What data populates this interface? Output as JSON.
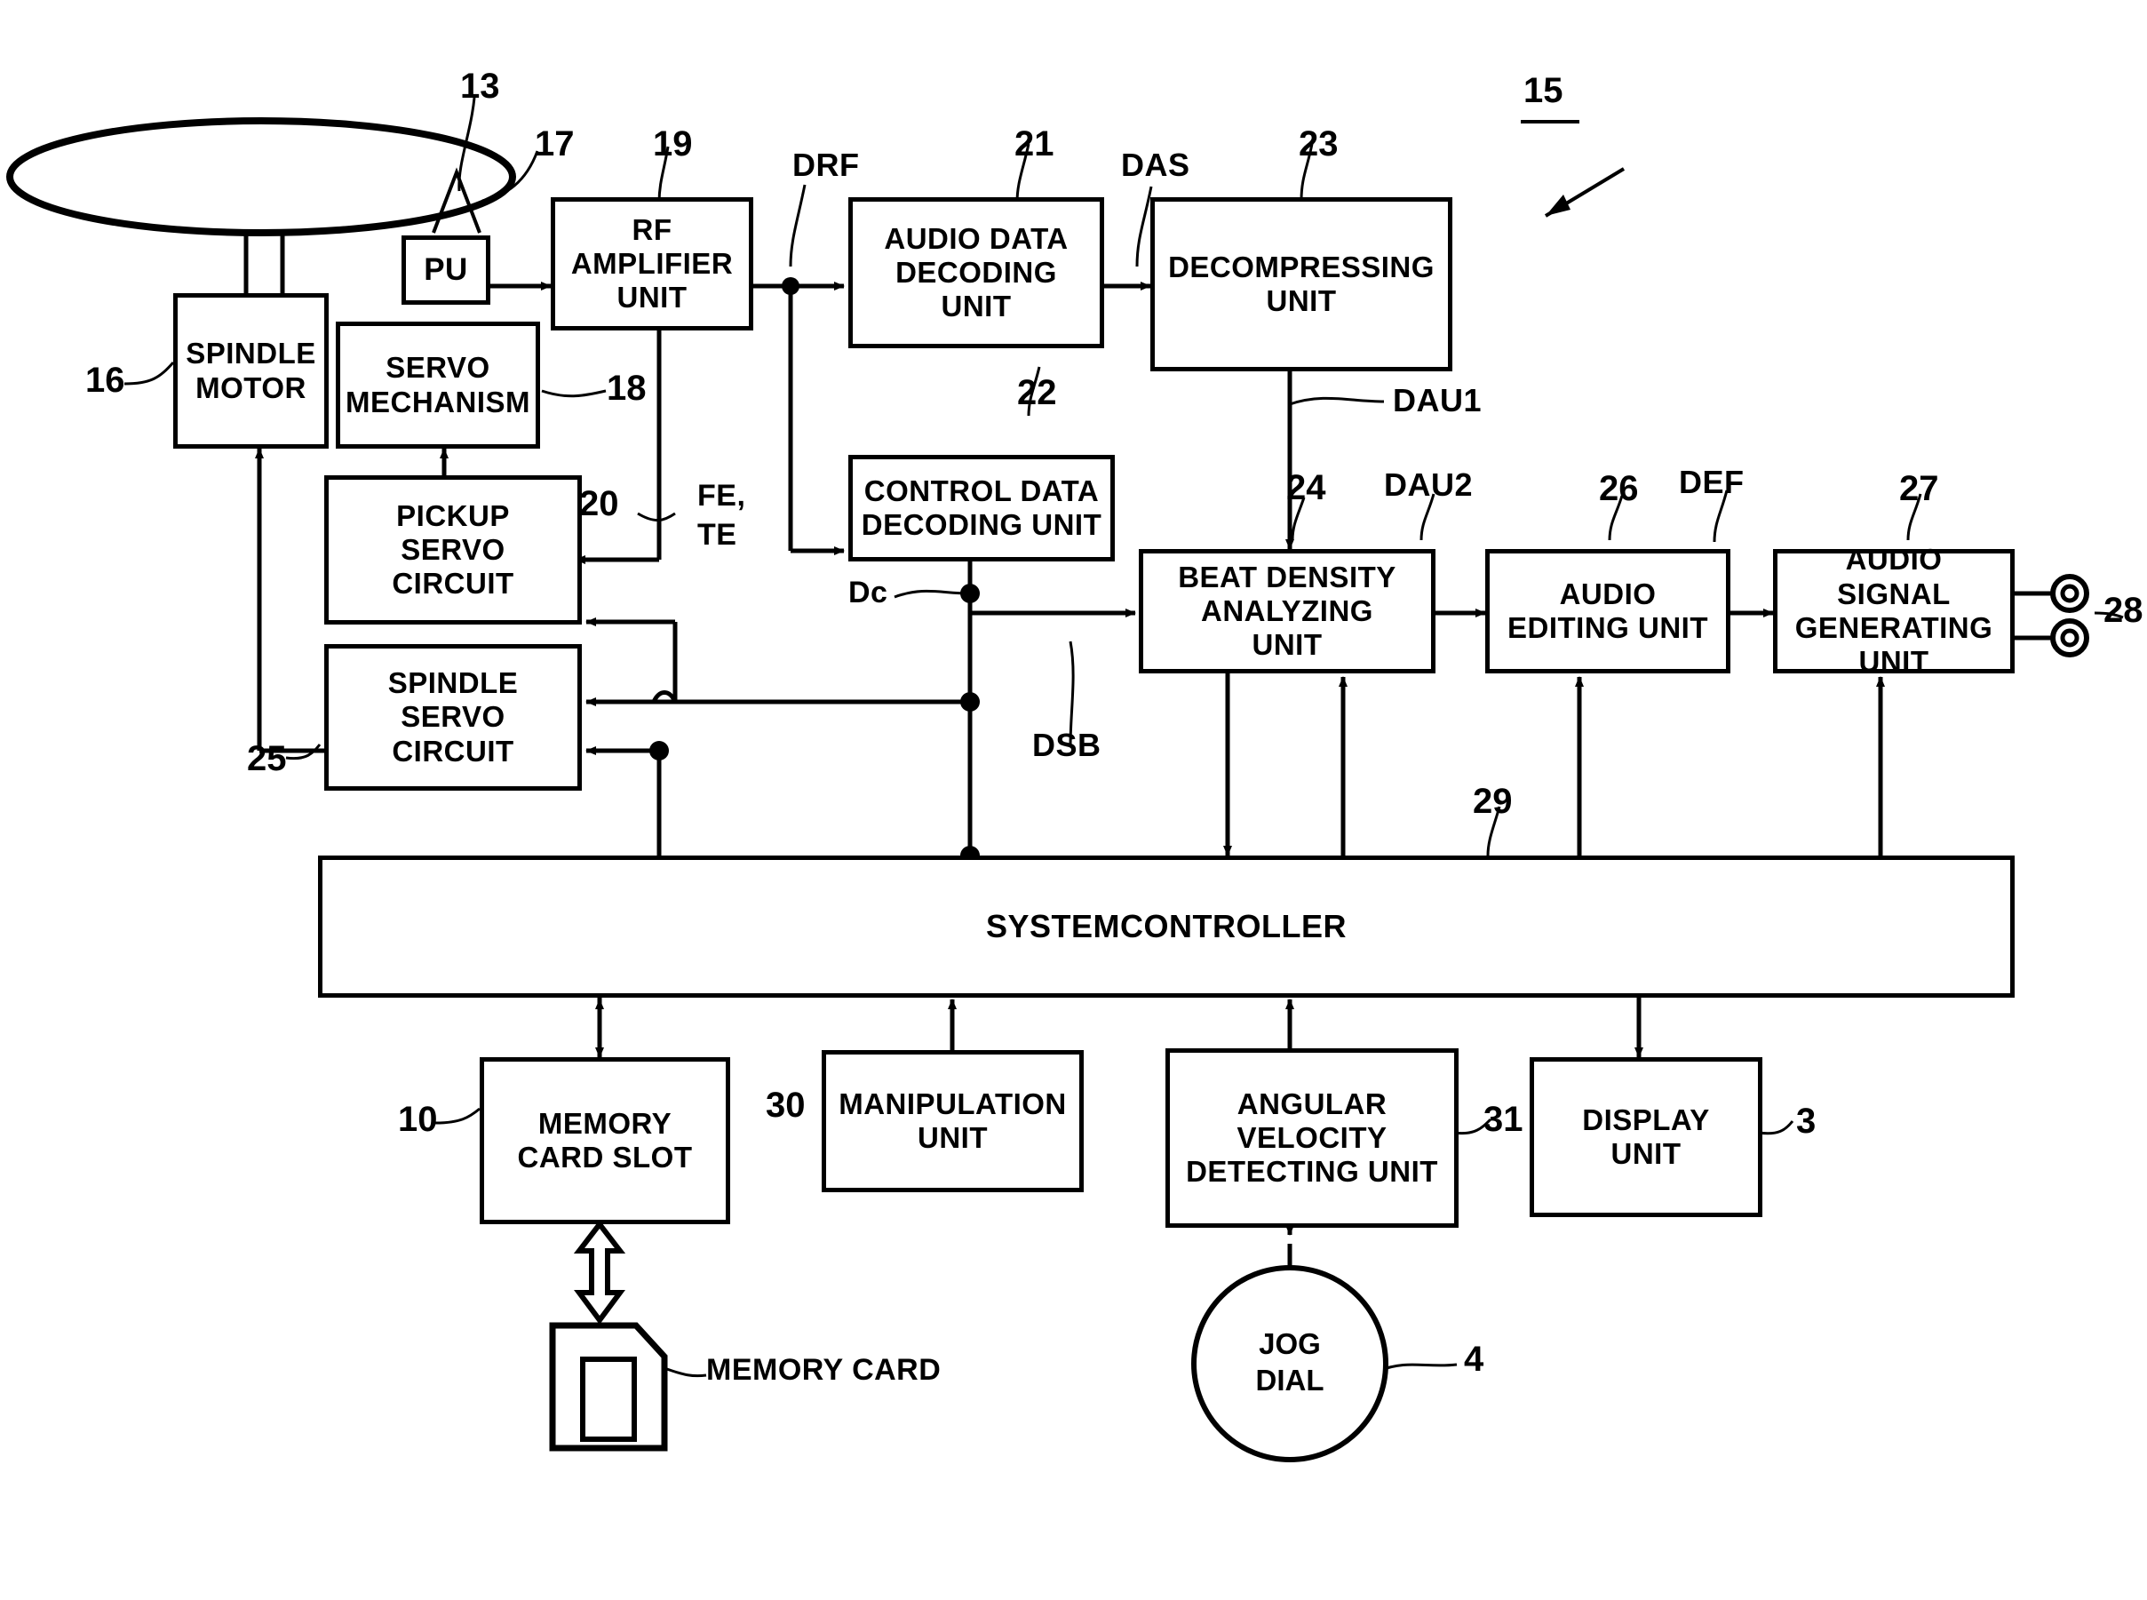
{
  "figure": {
    "kind": "patent-block-diagram",
    "title_ref": "15",
    "background": "#ffffff",
    "ink": "#000000"
  },
  "blocks": {
    "spindle_motor": {
      "label": "SPINDLE\nMOTOR",
      "line1": "SPINDLE",
      "line2": "MOTOR",
      "ref": "16"
    },
    "servo_mechanism": {
      "line1": "SERVO",
      "line2": "MECHANISM",
      "ref": "18"
    },
    "pu": {
      "line1": "PU",
      "ref": "17"
    },
    "rf_amplifier": {
      "line1": "RF",
      "line2": "AMPLIFIER",
      "line3": "UNIT",
      "ref": "19"
    },
    "audio_data_decoding": {
      "line1": "AUDIO DATA",
      "line2": "DECODING",
      "line3": "UNIT",
      "ref": "21"
    },
    "decompressing": {
      "line1": "DECOMPRESSING",
      "line2": "UNIT",
      "ref": "23"
    },
    "control_data_decoding": {
      "line1": "CONTROL DATA",
      "line2": "DECODING UNIT",
      "ref": "22"
    },
    "pickup_servo": {
      "line1": "PICKUP",
      "line2": "SERVO",
      "line3": "CIRCUIT",
      "ref": "20"
    },
    "spindle_servo": {
      "line1": "SPINDLE",
      "line2": "SERVO",
      "line3": "CIRCUIT",
      "ref": "25"
    },
    "beat_density": {
      "line1": "BEAT DENSITY",
      "line2": "ANALYZING",
      "line3": "UNIT",
      "ref": "24"
    },
    "audio_editing": {
      "line1": "AUDIO",
      "line2": "EDITING UNIT",
      "ref": "26"
    },
    "audio_signal_generating": {
      "line1": "AUDIO SIGNAL",
      "line2": "GENERATING",
      "line3": "UNIT",
      "ref": "27"
    },
    "system_controller": {
      "line1": "SYSTEMCONTROLLER",
      "ref": "29"
    },
    "memory_card_slot": {
      "line1": "MEMORY",
      "line2": "CARD SLOT",
      "ref": "10"
    },
    "manipulation_unit": {
      "line1": "MANIPULATION",
      "line2": "UNIT",
      "ref": "30"
    },
    "angular_velocity": {
      "line1": "ANGULAR",
      "line2": "VELOCITY",
      "line3": "DETECTING UNIT",
      "ref": "31"
    },
    "display_unit": {
      "line1": "DISPLAY",
      "line2": "UNIT",
      "ref": "3"
    },
    "jog_dial": {
      "line1": "JOG",
      "line2": "DIAL",
      "ref": "4"
    },
    "memory_card": {
      "label": "MEMORY CARD"
    },
    "disc": {
      "ref": "13"
    },
    "output_jacks": {
      "ref": "28"
    }
  },
  "signals": {
    "drf": "DRF",
    "das": "DAS",
    "dau1": "DAU1",
    "dau2": "DAU2",
    "def": "DEF",
    "dc": "Dc",
    "dsb": "DSB",
    "fe_te_line1": "FE,",
    "fe_te_line2": "TE"
  },
  "refs": {
    "r3": "3",
    "r4": "4",
    "r10": "10",
    "r13": "13",
    "r15": "15",
    "r16": "16",
    "r17": "17",
    "r18": "18",
    "r19": "19",
    "r20": "20",
    "r21": "21",
    "r22": "22",
    "r23": "23",
    "r24": "24",
    "r25": "25",
    "r26": "26",
    "r27": "27",
    "r28": "28",
    "r29": "29",
    "r30": "30",
    "r31": "31"
  }
}
